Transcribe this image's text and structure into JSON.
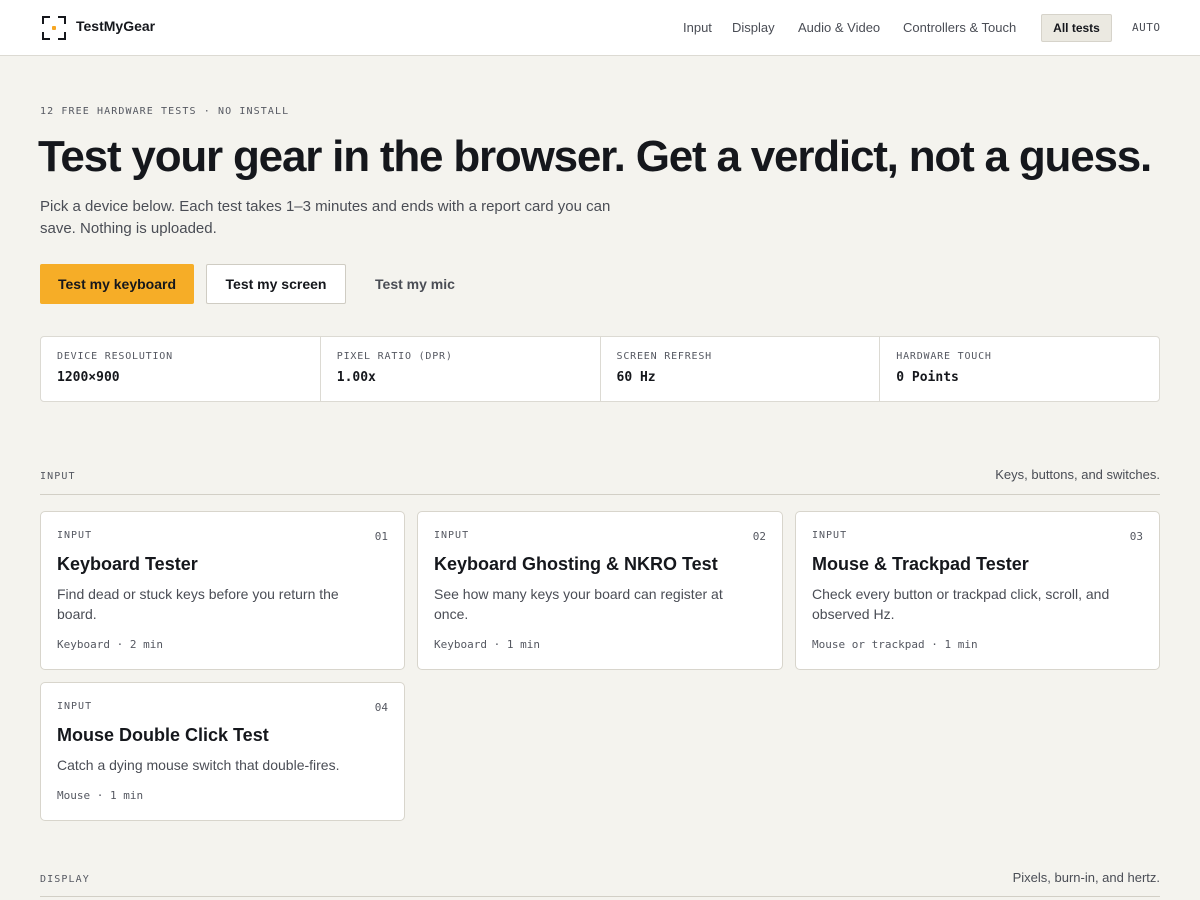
{
  "header": {
    "brand": "TestMyGear",
    "nav": [
      "Input",
      "Display",
      "Audio & Video",
      "Controllers & Touch"
    ],
    "all_tests": "All tests",
    "theme": "AUTO"
  },
  "hero": {
    "eyebrow": "12 FREE HARDWARE TESTS · NO INSTALL",
    "title": "Test your gear in the browser. Get a verdict, not a guess.",
    "subtitle": "Pick a device below. Each test takes 1–3 minutes and ends with a report card you can save. Nothing is uploaded.",
    "buttons": {
      "primary": "Test my keyboard",
      "secondary": "Test my screen",
      "ghost": "Test my mic"
    }
  },
  "stats": [
    {
      "label": "DEVICE RESOLUTION",
      "value": "1200×900"
    },
    {
      "label": "PIXEL RATIO (DPR)",
      "value": "1.00x"
    },
    {
      "label": "SCREEN REFRESH",
      "value": "60 Hz"
    },
    {
      "label": "HARDWARE TOUCH",
      "value": "0 Points"
    }
  ],
  "sections": {
    "input": {
      "label": "INPUT",
      "note": "Keys, buttons, and switches.",
      "cards": [
        {
          "category": "INPUT",
          "number": "01",
          "title": "Keyboard Tester",
          "description": "Find dead or stuck keys before you return the board.",
          "meta": "Keyboard · 2 min"
        },
        {
          "category": "INPUT",
          "number": "02",
          "title": "Keyboard Ghosting & NKRO Test",
          "description": "See how many keys your board can register at once.",
          "meta": "Keyboard · 1 min"
        },
        {
          "category": "INPUT",
          "number": "03",
          "title": "Mouse & Trackpad Tester",
          "description": "Check every button or trackpad click, scroll, and observed Hz.",
          "meta": "Mouse or trackpad · 1 min"
        },
        {
          "category": "INPUT",
          "number": "04",
          "title": "Mouse Double Click Test",
          "description": "Catch a dying mouse switch that double-fires.",
          "meta": "Mouse · 1 min"
        }
      ]
    },
    "display": {
      "label": "DISPLAY",
      "note": "Pixels, burn-in, and hertz."
    }
  },
  "colors": {
    "background": "#f4f3ee",
    "accent": "#f6ad27",
    "text": "#15171c"
  }
}
